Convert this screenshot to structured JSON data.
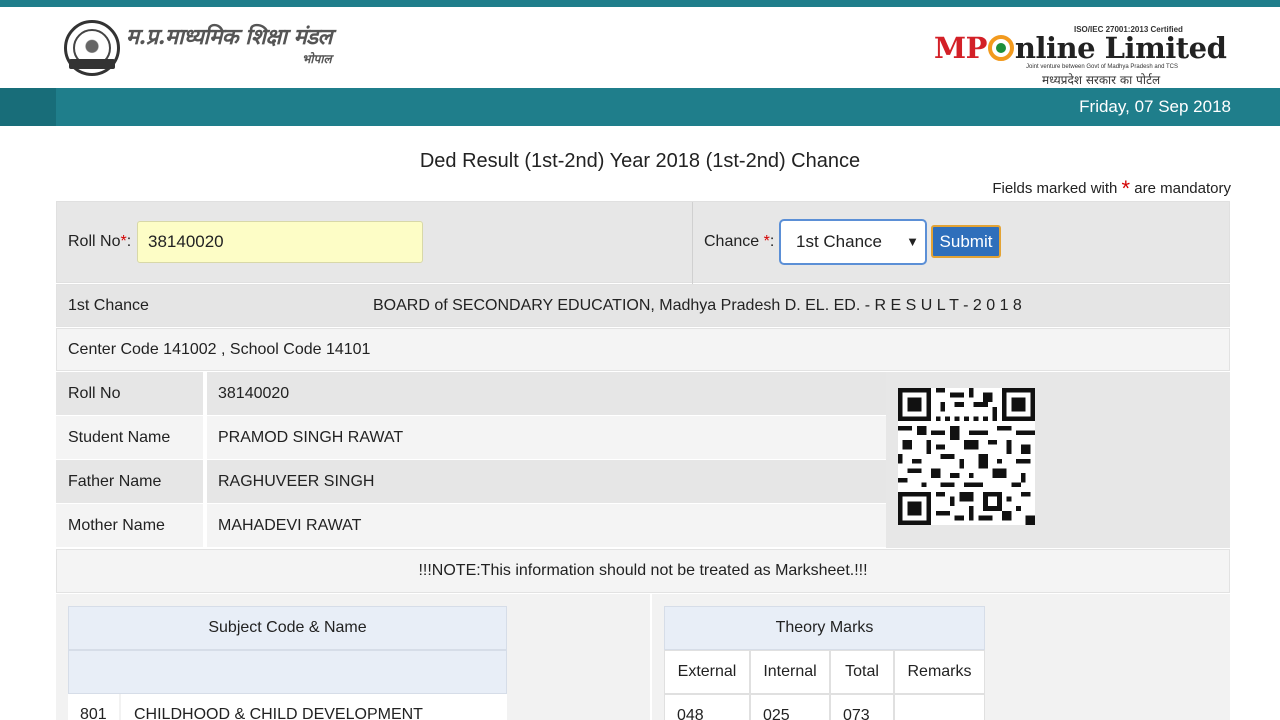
{
  "header": {
    "board_name": "म.प्र.माध्यमिक शिक्षा मंडल",
    "board_city": "भोपाल",
    "mp_cert": "ISO/IEC 27001:2013 Certified",
    "mp_logo_prefix": "MP",
    "mp_logo_suffix": "nline Limited",
    "mp_tagline": "Joint venture between Govt of Madhya Pradesh and TCS",
    "mp_hindi": "मध्यप्रदेश सरकार का पोर्टल"
  },
  "datebar": {
    "date": "Friday, 07 Sep 2018"
  },
  "page": {
    "title": "Ded Result (1st-2nd) Year 2018 (1st-2nd) Chance",
    "mandatory_prefix": "Fields marked with",
    "mandatory_star": "*",
    "mandatory_suffix": "are mandatory"
  },
  "form": {
    "roll_label": "Roll No",
    "roll_req": "*",
    "roll_colon": ":",
    "roll_value": "38140020",
    "chance_label": "Chance ",
    "chance_req": "*",
    "chance_colon": ":",
    "chance_value": "1st Chance",
    "chance_arrow": "▼",
    "submit_label": "Submit"
  },
  "result": {
    "chance": "1st Chance",
    "board_line": "BOARD of SECONDARY EDUCATION, Madhya Pradesh D. EL. ED. - R E S U L T - 2 0 1 8",
    "center_line": "Center Code 141002 , School Code 14101",
    "rows": [
      {
        "key": "Roll No",
        "value": "38140020"
      },
      {
        "key": "Student Name",
        "value": "PRAMOD SINGH RAWAT"
      },
      {
        "key": "Father Name",
        "value": "RAGHUVEER SINGH"
      },
      {
        "key": "Mother Name",
        "value": "MAHADEVI RAWAT"
      }
    ],
    "note": "!!!NOTE:This information should not be treated as Marksheet.!!!"
  },
  "marks": {
    "subject_header": "Subject Code & Name",
    "theory_header": "Theory Marks",
    "theory_columns": [
      "External",
      "Internal",
      "Total",
      "Remarks"
    ],
    "subjects": [
      {
        "code": "801",
        "name": "CHILDHOOD & CHILD DEVELOPMENT",
        "external": "048",
        "internal": "025",
        "total": "073"
      }
    ]
  },
  "colors": {
    "teal_bar": "#1f7e8b",
    "mandatory_star": "#d40000",
    "submit_bg": "#2f6fbb",
    "submit_border": "#e3a335",
    "input_bg": "#fdfdc6"
  }
}
